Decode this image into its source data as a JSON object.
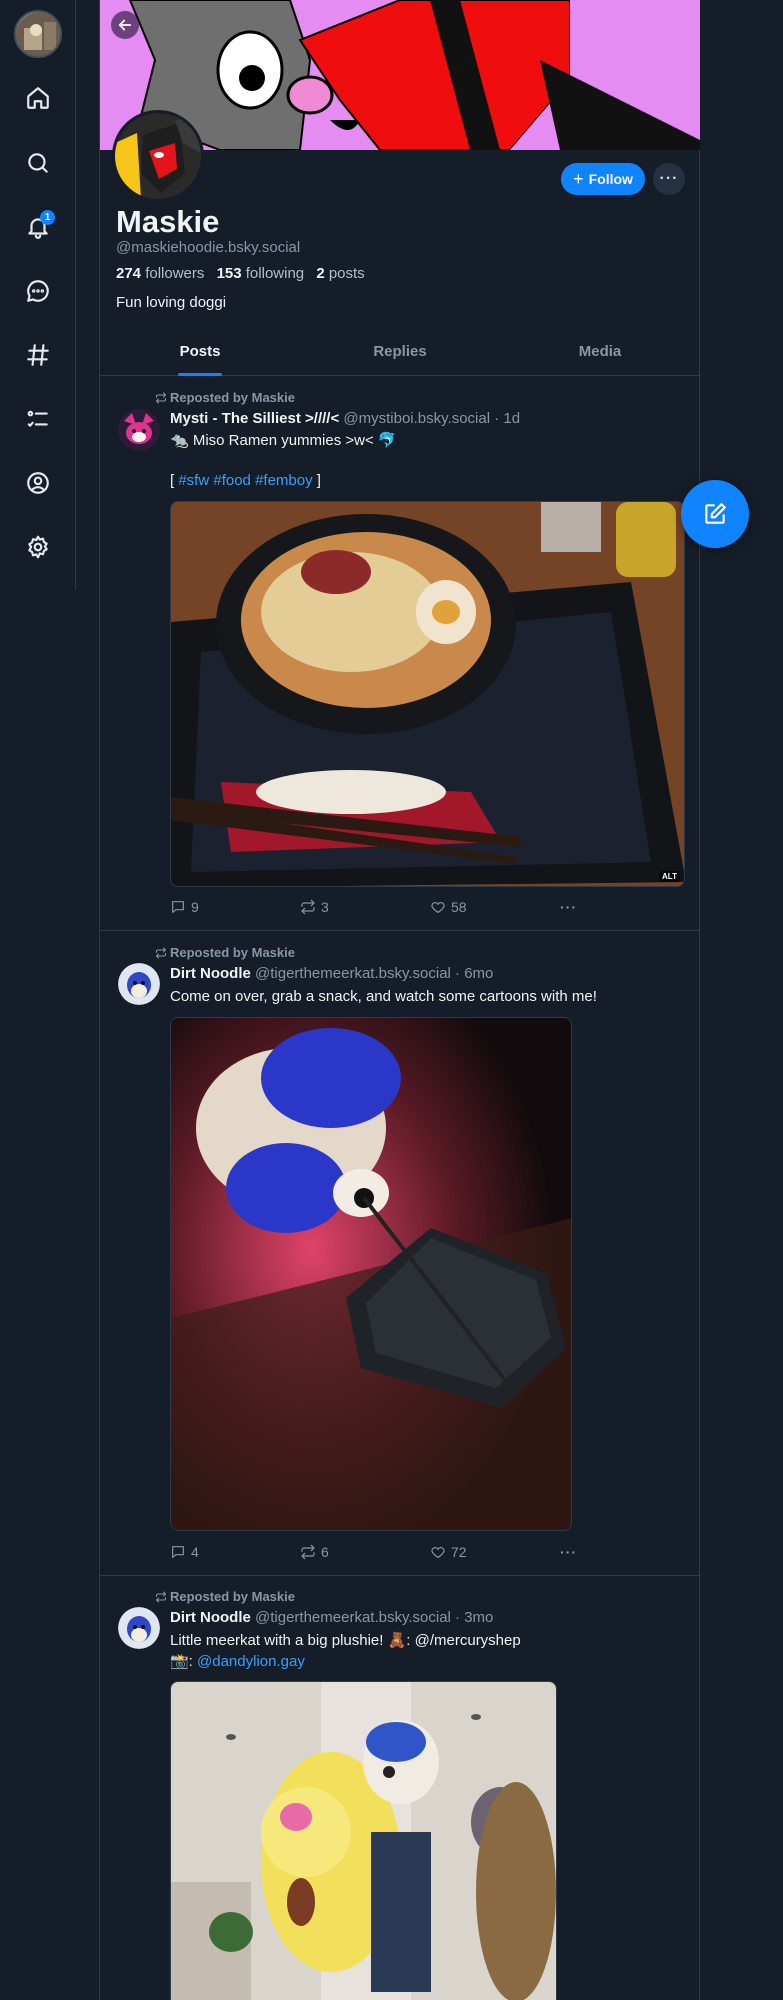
{
  "nav": {
    "notifications_count": "1",
    "items": [
      "home",
      "search",
      "notifications",
      "chat",
      "feeds",
      "lists",
      "profile",
      "settings"
    ]
  },
  "profile": {
    "display_name": "Maskie",
    "handle": "@maskiehoodie.bsky.social",
    "followers_count": "274",
    "followers_label": "followers",
    "following_count": "153",
    "following_label": "following",
    "posts_count": "2",
    "posts_label": "posts",
    "bio": "Fun loving doggi",
    "follow_label": "Follow",
    "banner_color": "#e48cf2"
  },
  "tabs": [
    {
      "label": "Posts",
      "active": true
    },
    {
      "label": "Replies",
      "active": false
    },
    {
      "label": "Media",
      "active": false
    }
  ],
  "posts": [
    {
      "repost_label": "Reposted by Maskie",
      "author": "Mysti - The Silliest >////<",
      "handle": "@mystiboi.bsky.social",
      "time": "· 1d",
      "text_line1": "🐀 Miso Ramen yummies >w< 🐬",
      "text_prefix": "[ ",
      "tags": [
        "#sfw",
        "#food",
        "#femboy"
      ],
      "text_suffix": " ]",
      "image_alt_badge": "ALT",
      "replies": "9",
      "reposts": "3",
      "likes": "58"
    },
    {
      "repost_label": "Reposted by Maskie",
      "author": "Dirt Noodle",
      "handle": "@tigerthemeerkat.bsky.social",
      "time": "· 6mo",
      "text_line1": "Come on over, grab a snack, and watch some cartoons with me!",
      "replies": "4",
      "reposts": "6",
      "likes": "72"
    },
    {
      "repost_label": "Reposted by Maskie",
      "author": "Dirt Noodle",
      "handle": "@tigerthemeerkat.bsky.social",
      "time": "· 3mo",
      "text_line1": "Little meerkat with a big plushie! 🧸: @/mercuryshep",
      "text_line2_prefix": "📸: ",
      "text_line2_link": "@dandylion.gay"
    }
  ],
  "colors": {
    "background": "#151d28",
    "accent": "#1083fe",
    "link": "#3c9ef8",
    "muted_text": "#8796a8"
  }
}
